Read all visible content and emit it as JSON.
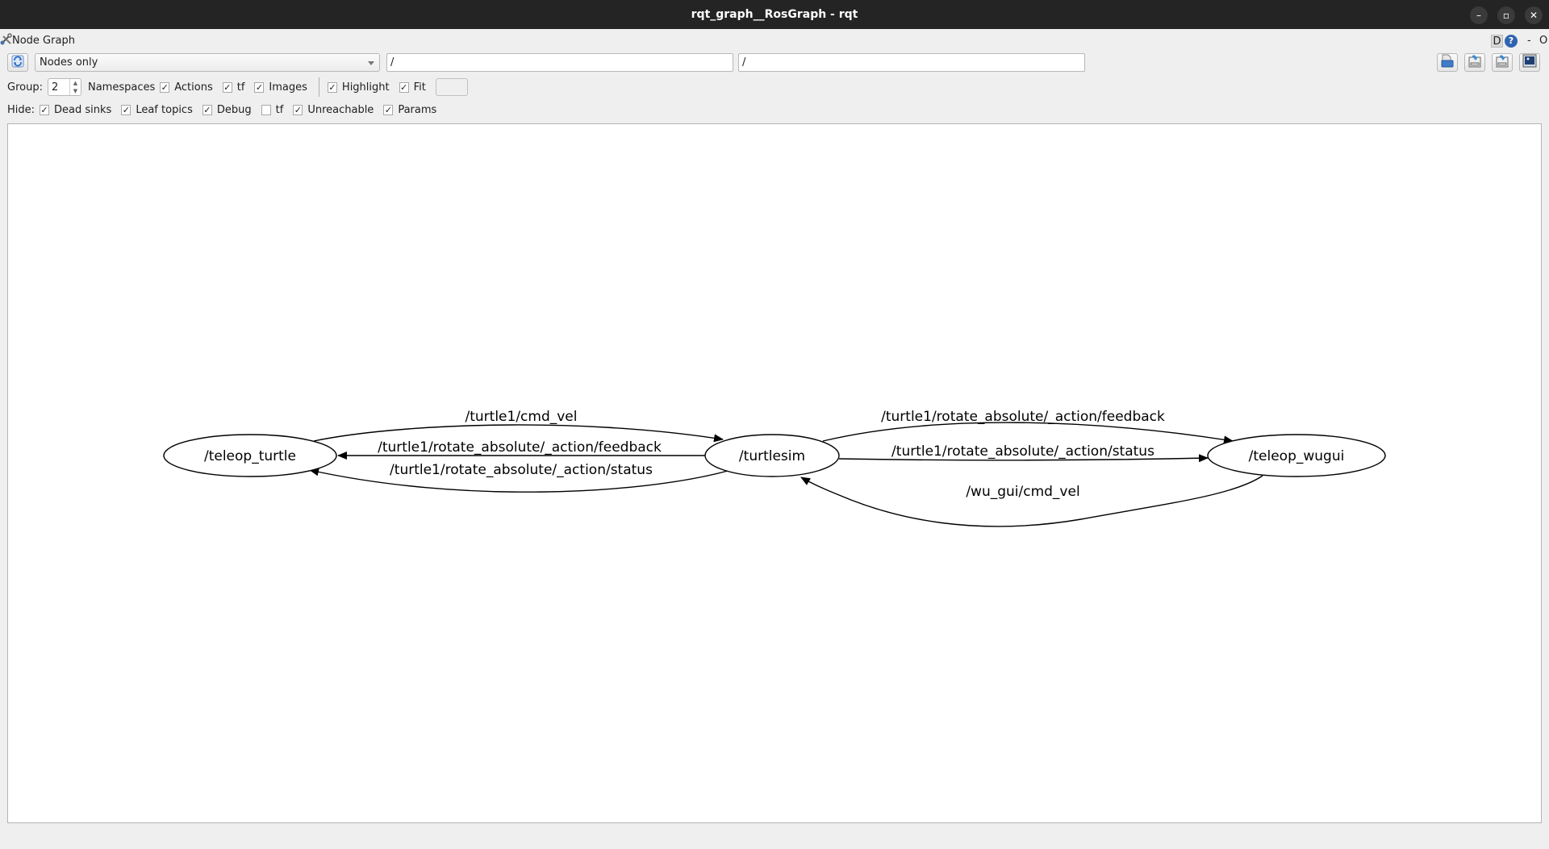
{
  "window": {
    "title": "rqt_graph__RosGraph - rqt",
    "controls": {
      "minimize": "–",
      "maximize": "▫",
      "close": "✕"
    }
  },
  "plugin": {
    "title": "Node Graph",
    "icon": "tools-icon",
    "right_controls": {
      "d_label": "D",
      "help": "?",
      "dash": "-",
      "o": "O"
    }
  },
  "toolbar": {
    "refresh_icon": "refresh-icon",
    "mode_select": {
      "value": "Nodes only"
    },
    "node_filter": {
      "value": "/"
    },
    "topic_filter": {
      "value": "/"
    },
    "right_buttons": [
      {
        "name": "load-dot-button",
        "icon": "open-file-icon"
      },
      {
        "name": "save-dot-button",
        "icon": "save-as-dot-icon"
      },
      {
        "name": "save-svg-button",
        "icon": "save-as-svg-icon"
      },
      {
        "name": "save-image-button",
        "icon": "save-image-icon"
      }
    ]
  },
  "options_row": {
    "group_label": "Group:",
    "group_value": "2",
    "items": [
      {
        "label": "Namespaces",
        "checked": null
      },
      {
        "label": "Actions",
        "checked": true
      },
      {
        "label": "tf",
        "checked": true
      },
      {
        "label": "Images",
        "checked": true
      },
      {
        "label": "Highlight",
        "checked": true
      },
      {
        "label": "Fit",
        "checked": true
      }
    ]
  },
  "hide_row": {
    "label": "Hide:",
    "items": [
      {
        "label": "Dead sinks",
        "checked": true
      },
      {
        "label": "Leaf topics",
        "checked": true
      },
      {
        "label": "Debug",
        "checked": true
      },
      {
        "label": "tf",
        "checked": false
      },
      {
        "label": "Unreachable",
        "checked": true
      },
      {
        "label": "Params",
        "checked": true
      }
    ]
  },
  "graph": {
    "nodes": [
      {
        "id": "teleop_turtle",
        "label": "/teleop_turtle"
      },
      {
        "id": "turtlesim",
        "label": "/turtlesim"
      },
      {
        "id": "teleop_wugui",
        "label": "/teleop_wugui"
      }
    ],
    "edges": [
      {
        "from": "teleop_turtle",
        "to": "turtlesim",
        "label": "/turtle1/cmd_vel"
      },
      {
        "from": "turtlesim",
        "to": "teleop_turtle",
        "label": "/turtle1/rotate_absolute/_action/feedback"
      },
      {
        "from": "turtlesim",
        "to": "teleop_turtle",
        "label": "/turtle1/rotate_absolute/_action/status"
      },
      {
        "from": "turtlesim",
        "to": "teleop_wugui",
        "label": "/turtle1/rotate_absolute/_action/feedback"
      },
      {
        "from": "turtlesim",
        "to": "teleop_wugui",
        "label": "/turtle1/rotate_absolute/_action/status"
      },
      {
        "from": "teleop_wugui",
        "to": "turtlesim",
        "label": "/wu_gui/cmd_vel"
      }
    ]
  }
}
